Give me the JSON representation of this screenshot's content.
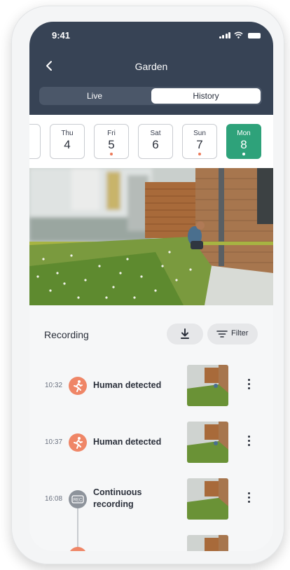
{
  "status": {
    "time": "9:41"
  },
  "header": {
    "title": "Garden"
  },
  "tabs": {
    "live": "Live",
    "history": "History",
    "selected": "History"
  },
  "dates": [
    {
      "name": "",
      "num": "",
      "dot": false,
      "active": false
    },
    {
      "name": "Thu",
      "num": "4",
      "dot": false,
      "active": false
    },
    {
      "name": "Fri",
      "num": "5",
      "dot": true,
      "active": false
    },
    {
      "name": "Sat",
      "num": "6",
      "dot": false,
      "active": false
    },
    {
      "name": "Sun",
      "num": "7",
      "dot": true,
      "active": false
    },
    {
      "name": "Mon",
      "num": "8",
      "dot": true,
      "active": true
    }
  ],
  "recordings": {
    "title": "Recording",
    "filter_label": "Filter",
    "items": [
      {
        "time": "10:32",
        "label": "Human detected",
        "icon": "person-running-icon"
      },
      {
        "time": "10:37",
        "label": "Human detected",
        "icon": "person-running-icon"
      },
      {
        "time": "16:08",
        "label": "Continuous recording",
        "icon": "rec-icon",
        "icon_text": "REC"
      }
    ]
  },
  "colors": {
    "header": "#374355",
    "accent": "#2ea27a",
    "event": "#ef8667",
    "rec": "#8d939b"
  }
}
